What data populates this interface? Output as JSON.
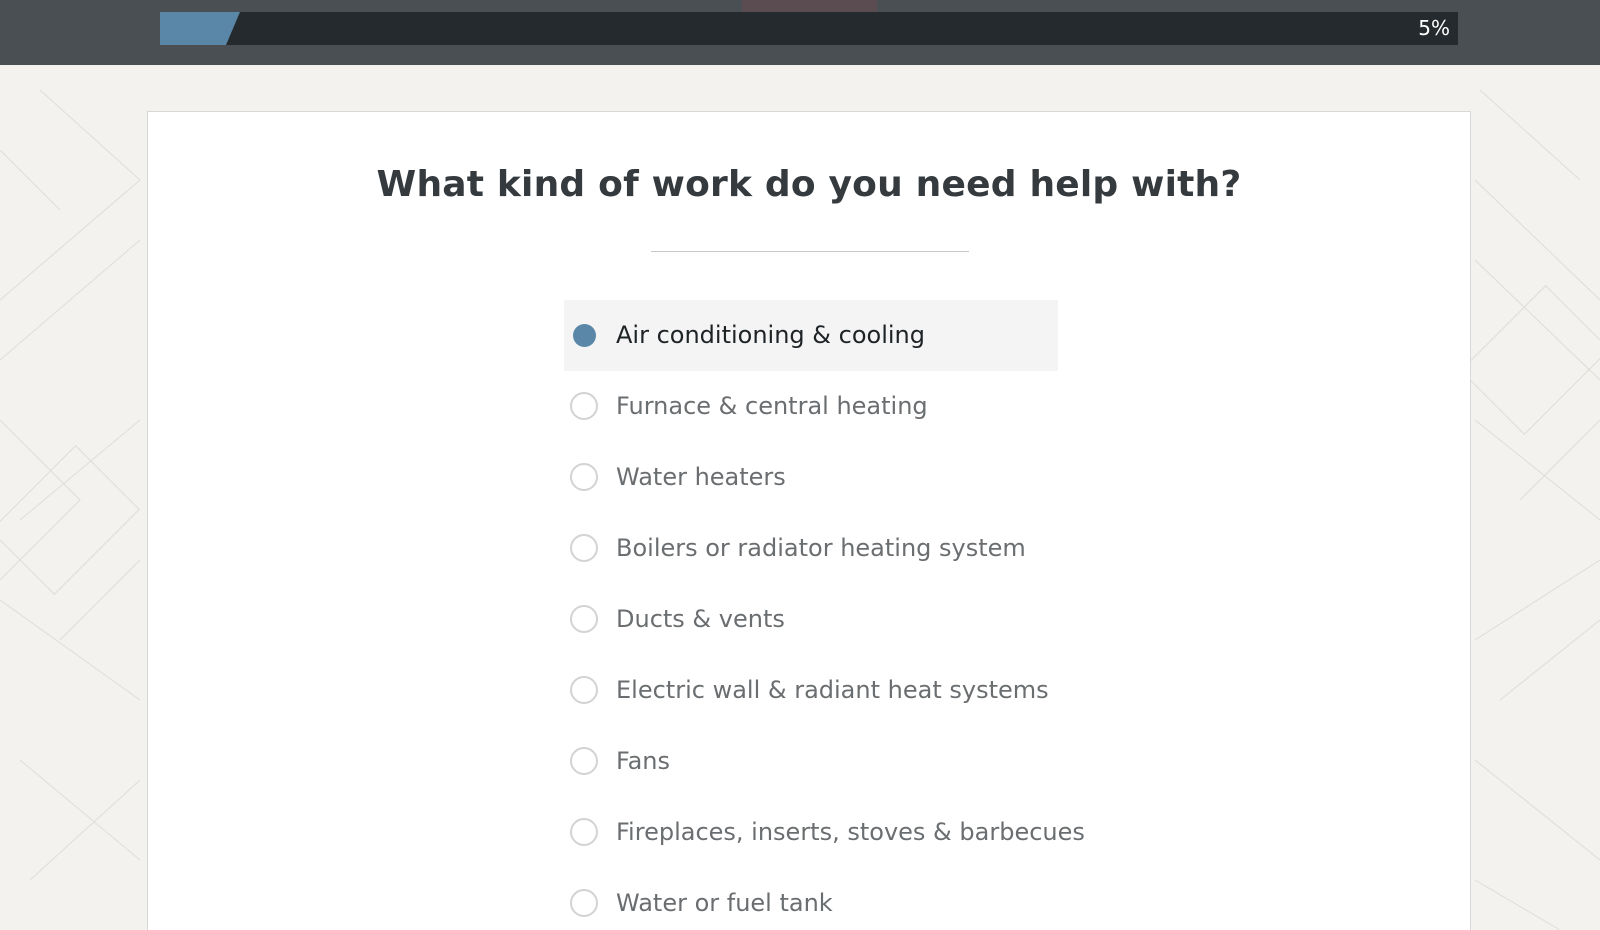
{
  "progress": {
    "percent": 5,
    "label": "5%",
    "fill_color": "#5a87a7",
    "track_color": "#252a2e"
  },
  "question": {
    "title": "What kind of work do you need help with?"
  },
  "options": [
    {
      "label": "Air conditioning & cooling",
      "selected": true
    },
    {
      "label": "Furnace & central heating",
      "selected": false
    },
    {
      "label": "Water heaters",
      "selected": false
    },
    {
      "label": "Boilers or radiator heating system",
      "selected": false
    },
    {
      "label": "Ducts & vents",
      "selected": false
    },
    {
      "label": "Electric wall & radiant heat systems",
      "selected": false
    },
    {
      "label": "Fans",
      "selected": false
    },
    {
      "label": "Fireplaces, inserts, stoves & barbecues",
      "selected": false
    },
    {
      "label": "Water or fuel tank",
      "selected": false
    }
  ],
  "colors": {
    "accent": "#5a87a7",
    "topbar": "#4a4f53",
    "page_background": "#f3f2ef"
  }
}
